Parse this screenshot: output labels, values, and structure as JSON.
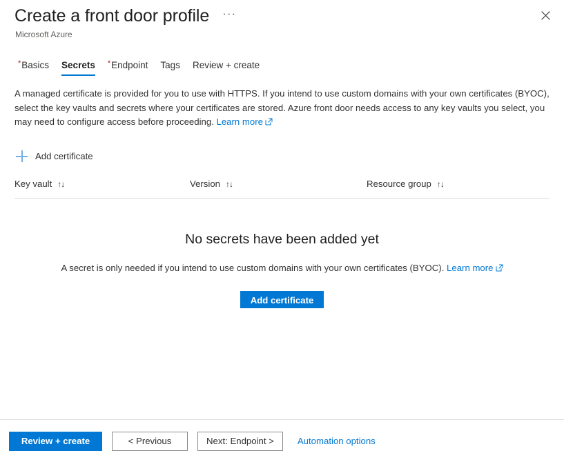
{
  "header": {
    "title": "Create a front door profile",
    "subtitle": "Microsoft Azure",
    "more_menu": "···",
    "close_label": "Close"
  },
  "tabs": [
    {
      "label": "Basics",
      "required": true,
      "active": false
    },
    {
      "label": "Secrets",
      "required": false,
      "active": true
    },
    {
      "label": "Endpoint",
      "required": true,
      "active": false
    },
    {
      "label": "Tags",
      "required": false,
      "active": false
    },
    {
      "label": "Review + create",
      "required": false,
      "active": false
    }
  ],
  "description": {
    "text": "A managed certificate is provided for you to use with HTTPS. If you intend to use custom domains with your own certificates (BYOC), select the key vaults and secrets where your certificates are stored. Azure front door needs access to any key vaults you select, you may need to configure access before proceeding.",
    "link_label": "Learn more"
  },
  "command_bar": {
    "add_certificate_label": "Add certificate"
  },
  "table": {
    "columns": [
      {
        "label": "Key vault",
        "sort": "↑↓"
      },
      {
        "label": "Version",
        "sort": "↑↓"
      },
      {
        "label": "Resource group",
        "sort": "↑↓"
      }
    ],
    "rows": []
  },
  "empty_state": {
    "title": "No secrets have been added yet",
    "subtitle": "A secret is only needed if you intend to use custom domains with your own certificates (BYOC).",
    "link_label": "Learn more",
    "button_label": "Add certificate"
  },
  "footer": {
    "review_create_label": "Review + create",
    "previous_label": "< Previous",
    "next_label": "Next: Endpoint >",
    "automation_label": "Automation options"
  },
  "colors": {
    "accent": "#0078d4",
    "required_asterisk": "#a4262c",
    "plus_icon": "#71afe5",
    "divider": "#e1dfdd"
  }
}
